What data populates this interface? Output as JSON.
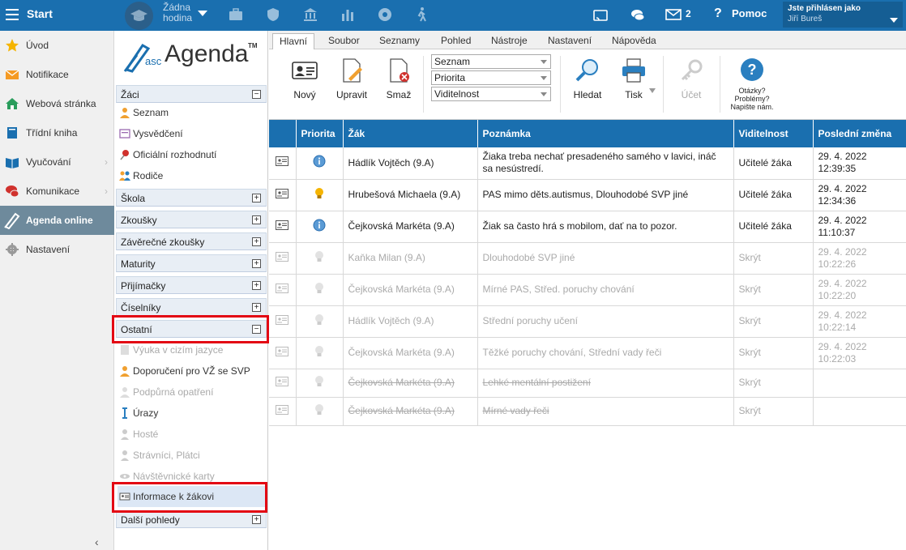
{
  "topbar": {
    "start": "Start",
    "hour_line1": "Žádna",
    "hour_line2": "hodina",
    "notif_count": "2",
    "help": "Pomoc",
    "help_q": "?",
    "login_label": "Jste přihlásen jako",
    "login_user": "Jiří Bureš"
  },
  "leftnav": [
    {
      "label": "Úvod",
      "icon": "star-icon"
    },
    {
      "label": "Notifikace",
      "icon": "envelope-icon"
    },
    {
      "label": "Webová stránka",
      "icon": "house-icon"
    },
    {
      "label": "Třídní kniha",
      "icon": "book-icon"
    },
    {
      "label": "Vyučování",
      "icon": "open-book-icon",
      "chevron": "›"
    },
    {
      "label": "Komunikace",
      "icon": "chat-icon",
      "chevron": "›"
    },
    {
      "label": "Agenda online",
      "icon": "pen-icon",
      "active": true
    },
    {
      "label": "Nastavení",
      "icon": "gear-icon"
    }
  ],
  "leftnav_collapse": "‹",
  "logo": {
    "asc": "asc",
    "agenda": "Agenda",
    "tm": "TM"
  },
  "tree": {
    "zaci": {
      "label": "Žáci",
      "pm": "−"
    },
    "zaci_items": [
      "Seznam",
      "Vysvědčení",
      "Oficiální rozhodnutí",
      "Rodiče"
    ],
    "sections": [
      {
        "label": "Škola",
        "pm": "+"
      },
      {
        "label": "Zkoušky",
        "pm": "+"
      },
      {
        "label": "Závěrečné zkoušky",
        "pm": "+"
      },
      {
        "label": "Maturity",
        "pm": "+"
      },
      {
        "label": "Přijímačky",
        "pm": "+"
      },
      {
        "label": "Číselníky",
        "pm": "+"
      }
    ],
    "ostatni": {
      "label": "Ostatní",
      "pm": "−"
    },
    "ostatni_items": [
      "Výuka v cizím jazyce",
      "Doporučení pro VŽ se SVP",
      "Podpůrná opatření",
      "Úrazy",
      "Hosté",
      "Strávníci, Plátci",
      "Návštěvnické karty",
      "Informace k žákovi"
    ],
    "dalsi": {
      "label": "Další pohledy",
      "pm": "+"
    }
  },
  "tabs": [
    "Hlavní",
    "Soubor",
    "Seznamy",
    "Pohled",
    "Nástroje",
    "Nastavení",
    "Nápověda"
  ],
  "ribbon": {
    "new": "Nový",
    "edit": "Upravit",
    "delete": "Smaž",
    "selects": [
      "Seznam",
      "Priorita",
      "Viditelnost"
    ],
    "search": "Hledat",
    "print": "Tisk",
    "account": "Účet",
    "question_line1": "Otázky?",
    "question_line2": "Problémy?",
    "question_line3": "Napište nám."
  },
  "grid": {
    "headers": [
      "Priorita",
      "Žák",
      "Poznámka",
      "Viditelnost",
      "Poslední změna"
    ],
    "rows": [
      {
        "prio": "info",
        "student": "Hádlík Vojtěch (9.A)",
        "note": "Žiaka treba nechať presadeného samého v lavici, ináč sa nesústredí.",
        "vis": "Učitelé žáka",
        "date": "29. 4. 2022",
        "time": "12:39:35"
      },
      {
        "prio": "bulb",
        "student": "Hrubešová Michaela (9.A)",
        "note": "PAS mimo děts.autismus, Dlouhodobé SVP jiné",
        "vis": "Učitelé žáka",
        "date": "29. 4. 2022",
        "time": "12:34:36"
      },
      {
        "prio": "info",
        "student": "Čejkovská Markéta (9.A)",
        "note": "Žiak sa často hrá s mobilom, dať na to pozor.",
        "vis": "Učitelé žáka",
        "date": "29. 4. 2022",
        "time": "11:10:37"
      },
      {
        "prio": "bulb-dim",
        "student": "Kaňka Milan (9.A)",
        "note": "Dlouhodobé SVP jiné",
        "vis": "Skrýt",
        "date": "29. 4. 2022",
        "time": "10:22:26",
        "hidden": true
      },
      {
        "prio": "bulb-dim",
        "student": "Čejkovská Markéta (9.A)",
        "note": "Mírné PAS, Střed. poruchy chování",
        "vis": "Skrýt",
        "date": "29. 4. 2022",
        "time": "10:22:20",
        "hidden": true
      },
      {
        "prio": "bulb-dim",
        "student": "Hádlík Vojtěch (9.A)",
        "note": "Střední poruchy učení",
        "vis": "Skrýt",
        "date": "29. 4. 2022",
        "time": "10:22:14",
        "hidden": true
      },
      {
        "prio": "bulb-dim",
        "student": "Čejkovská Markéta (9.A)",
        "note": "Těžké poruchy chování, Střední vady řeči",
        "vis": "Skrýt",
        "date": "29. 4. 2022",
        "time": "10:22:03",
        "hidden": true
      },
      {
        "prio": "bulb-dim",
        "student": "Čejkovská Markéta (9.A)",
        "note": "Lehké mentální postižení",
        "vis": "Skrýt",
        "date": "",
        "time": "",
        "hidden": true,
        "strike": true
      },
      {
        "prio": "bulb-dim",
        "student": "Čejkovská Markéta (9.A)",
        "note": "Mírné vady řeči",
        "vis": "Skrýt",
        "date": "",
        "time": "",
        "hidden": true,
        "strike": true
      }
    ]
  }
}
